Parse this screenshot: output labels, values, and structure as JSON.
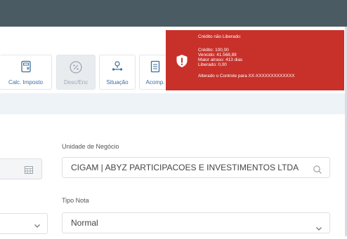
{
  "toolbar": {
    "buttons": [
      {
        "label": "Calc. Imposto",
        "icon": "calculator-icon"
      },
      {
        "label": "Desc/Enc",
        "icon": "percent-icon",
        "disabled": true
      },
      {
        "label": "Situação",
        "icon": "status-flow-icon"
      },
      {
        "label": "Acomp.",
        "icon": "list-document-icon"
      }
    ]
  },
  "toast": {
    "title": "Crédito não Liberado:",
    "credito": "Crédito: 100,00",
    "vencido": "Vencido: 41.568,89",
    "maior_atraso": "Maior atraso: 413 dias",
    "liberado": "Liberado: 0,00",
    "alterado": "Alterado o Controle para XX-XXXXXXXXXXXXX",
    "color": "#c8302a"
  },
  "form": {
    "unidade_label": "Unidade de Negócio",
    "unidade_value": "CIGAM | ABYZ PARTICIPACOES E INVESTIMENTOS LTDA",
    "tipo_nota_label": "Tipo Nota",
    "tipo_nota_value": "Normal"
  },
  "colors": {
    "topbar": "#4b5b64",
    "accent": "#3c6e9c",
    "band": "#eef3f8"
  }
}
